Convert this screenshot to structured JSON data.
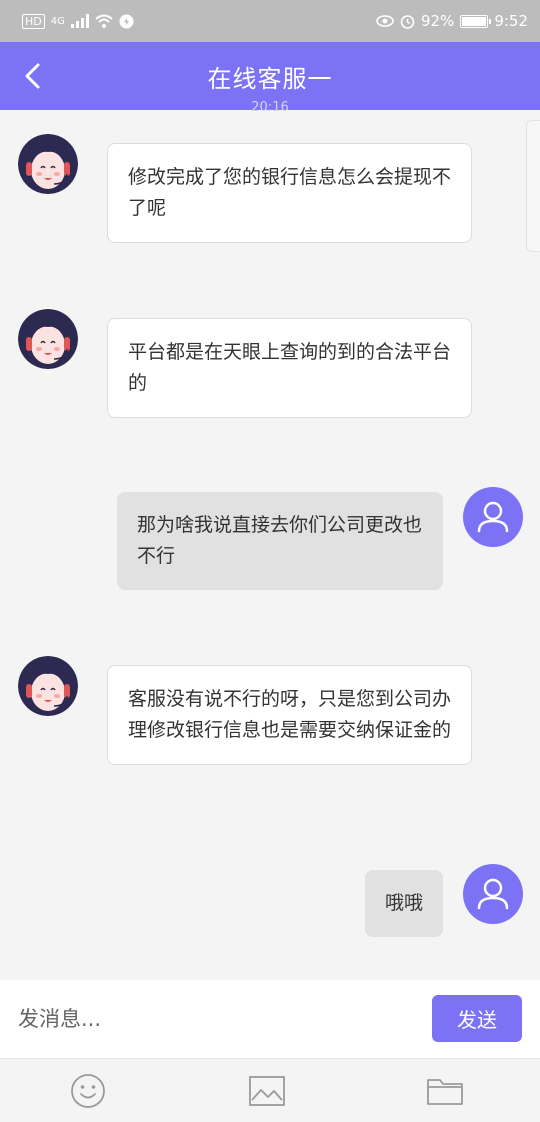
{
  "status_bar": {
    "network": "HD",
    "signal_type": "4G",
    "battery": "92%",
    "battery_level": 0.92,
    "time": "9:52"
  },
  "header": {
    "title": "在线客服一",
    "back_icon": "chevron-left-icon"
  },
  "chat": {
    "ghost_time": "20:16",
    "messages": [
      {
        "from": "agent",
        "text": "修改完成了您的银行信息怎么会提现不了呢"
      },
      {
        "from": "agent",
        "text": "平台都是在天眼上查询的到的合法平台的"
      },
      {
        "from": "user",
        "text": "那为啥我说直接去你们公司更改也不行"
      },
      {
        "from": "agent",
        "text": "客服没有说不行的呀，只是您到公司办理修改银行信息也是需要交纳保证金的"
      },
      {
        "from": "user",
        "text": "哦哦"
      }
    ]
  },
  "composer": {
    "placeholder": "发消息...",
    "send_label": "发送"
  },
  "toolbar": {
    "icons": [
      "emoji-icon",
      "image-icon",
      "folder-icon"
    ]
  },
  "colors": {
    "accent": "#7b72f5",
    "status_bar": "#bcbcbc",
    "background": "#f4f4f4",
    "user_bubble": "#e1e1e1",
    "agent_bubble": "#ffffff"
  }
}
